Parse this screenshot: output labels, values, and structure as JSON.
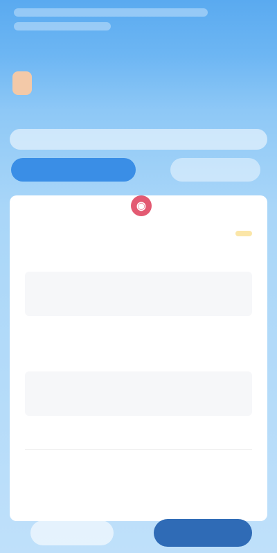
{
  "brand": {
    "label": ""
  },
  "notice": {
    "text": ""
  },
  "tabs": [
    {
      "label": ""
    },
    {
      "label": ""
    }
  ],
  "card": {
    "logo_icon": "brand-logo-icon",
    "title": "",
    "status": "",
    "rows": [
      {
        "label": "",
        "value": ""
      },
      {
        "label": "",
        "value": ""
      },
      {
        "label": "",
        "value": ""
      },
      {
        "label": "",
        "value": ""
      },
      {
        "label": "",
        "value": ""
      }
    ],
    "info_boxes": [
      {
        "text": ""
      },
      {
        "text": ""
      }
    ]
  },
  "actions": {
    "secondary_label": "",
    "primary_label": ""
  },
  "colors": {
    "primary": "#2f6bb6",
    "tab_active": "#3a8ee6",
    "badge_bg": "#fbe6a8",
    "badge_text": "#c9961a",
    "logo": "#e35a72"
  }
}
